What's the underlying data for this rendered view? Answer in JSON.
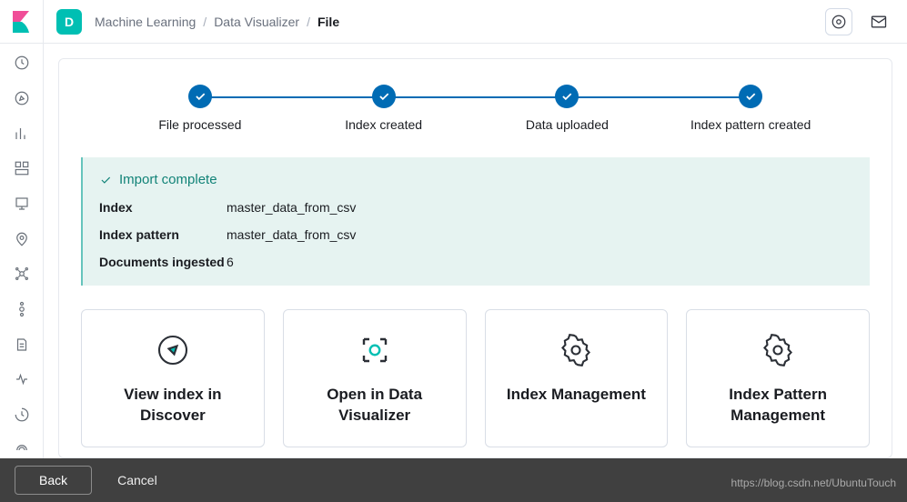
{
  "header": {
    "space_initial": "D",
    "breadcrumbs": [
      "Machine Learning",
      "Data Visualizer",
      "File"
    ]
  },
  "steps": [
    {
      "label": "File processed"
    },
    {
      "label": "Index created"
    },
    {
      "label": "Data uploaded"
    },
    {
      "label": "Index pattern created"
    }
  ],
  "callout": {
    "title": "Import complete",
    "rows": {
      "index_key": "Index",
      "index_val": "master_data_from_csv",
      "pattern_key": "Index pattern",
      "pattern_val": "master_data_from_csv",
      "docs_key": "Documents ingested",
      "docs_val": "6"
    }
  },
  "cards": [
    {
      "title": "View index in Discover"
    },
    {
      "title": "Open in Data Visualizer"
    },
    {
      "title": "Index Management"
    },
    {
      "title": "Index Pattern Management"
    }
  ],
  "footer": {
    "back": "Back",
    "cancel": "Cancel"
  },
  "watermark": "https://blog.csdn.net/UbuntuTouch"
}
